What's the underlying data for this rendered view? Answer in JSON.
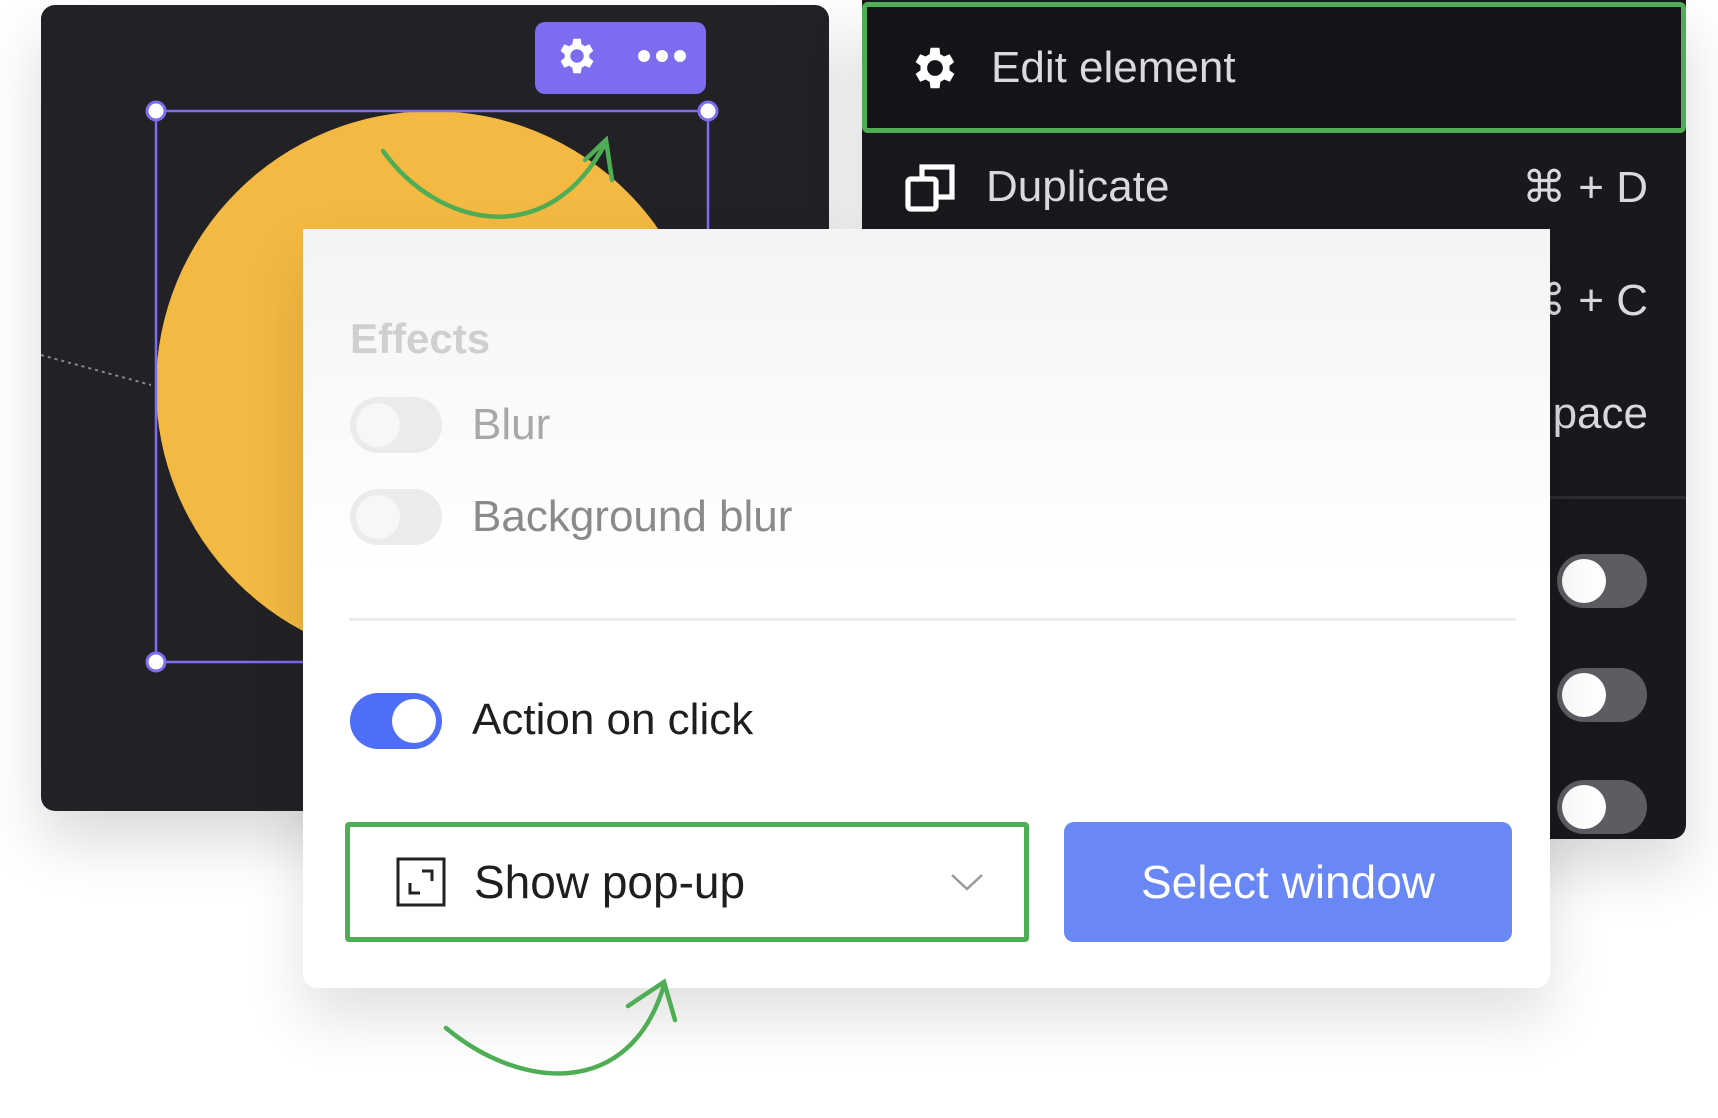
{
  "canvas": {
    "shape_color": "#f4b942",
    "selection_color": "#7b6cf0",
    "toolbar_icons": [
      "gear-icon",
      "more-horizontal-icon"
    ]
  },
  "context_menu": {
    "items": [
      {
        "label": "Edit element",
        "icon": "gear-icon",
        "shortcut": ""
      },
      {
        "label": "Duplicate",
        "icon": "duplicate-icon",
        "shortcut": "⌘ + D"
      },
      {
        "label": "",
        "shortcut": "⌘ + C"
      },
      {
        "label": "pace",
        "shortcut": ""
      }
    ],
    "toggles": [
      false,
      false,
      false
    ]
  },
  "panel": {
    "section_title": "Effects",
    "blur": {
      "label": "Blur",
      "on": false
    },
    "background_blur": {
      "label": "Background blur",
      "on": false
    },
    "action_on_click": {
      "label": "Action on click",
      "on": true
    },
    "action_select": {
      "value": "Show pop-up",
      "icon": "expand-icon"
    },
    "select_window_label": "Select window"
  },
  "colors": {
    "accent": "#4f6ef7",
    "highlight": "#4fae55",
    "button": "#6a88f5"
  }
}
